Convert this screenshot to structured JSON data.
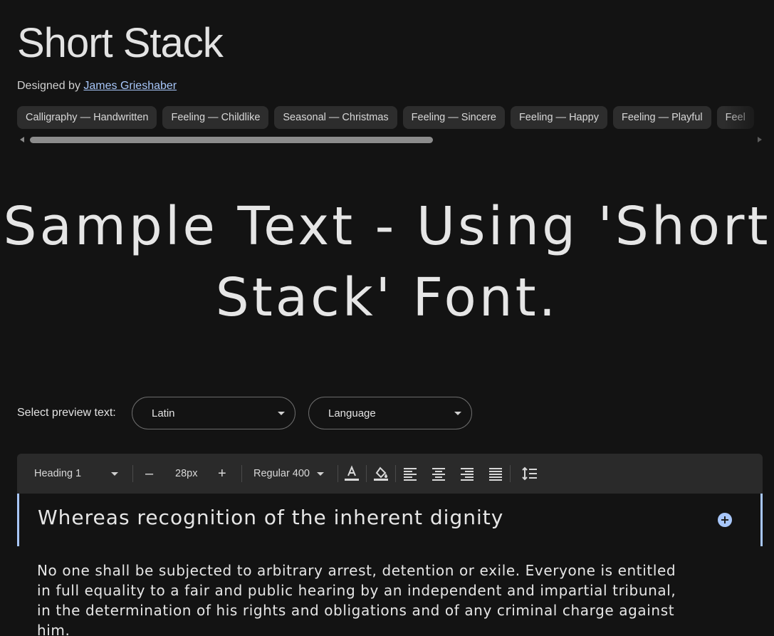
{
  "font": {
    "name": "Short Stack",
    "designer_prefix": "Designed by",
    "designer_name": "James Grieshaber"
  },
  "tags": [
    "Calligraphy — Handwritten",
    "Feeling — Childlike",
    "Seasonal — Christmas",
    "Feeling — Sincere",
    "Feeling — Happy",
    "Feeling — Playful",
    "Feel"
  ],
  "sample_text": "Sample Text - Using 'Short Stack' Font.",
  "preview": {
    "label": "Select preview text:",
    "script_value": "Latin",
    "language_value": "Language"
  },
  "toolbar": {
    "style": "Heading 1",
    "decrease": "–",
    "size": "28px",
    "increase": "+",
    "weight": "Regular 400"
  },
  "editor": {
    "heading": "Whereas recognition of the inherent dignity",
    "paragraph": "No one shall be subjected to arbitrary arrest, detention or exile. Everyone is entitled in full equality to a fair and public hearing by an independent and impartial tribunal, in the determination of his rights and obligations and of any criminal charge against him."
  },
  "colors": {
    "background": "#131313",
    "accent": "#a8c7fa",
    "chip": "#2d2d2d",
    "toolbar": "#2a2a2a"
  },
  "icons": [
    "text-color-icon",
    "highlight-color-icon",
    "align-left-icon",
    "align-center-icon",
    "align-right-icon",
    "align-justify-icon",
    "line-spacing-icon",
    "add-circle-icon"
  ]
}
